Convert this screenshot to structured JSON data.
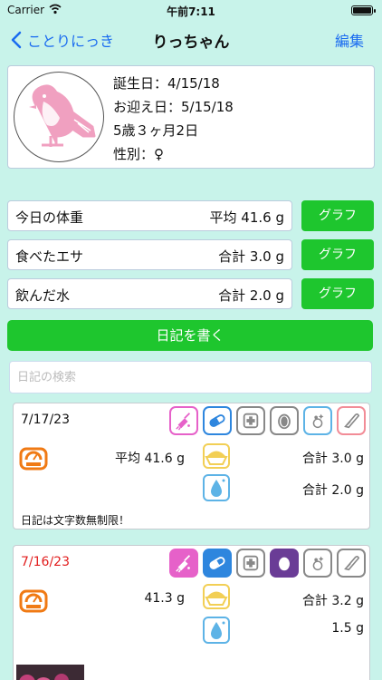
{
  "status_bar": {
    "carrier": "Carrier",
    "time": "午前7:11"
  },
  "nav": {
    "back_label": "ことりにっき",
    "title": "りっちゃん",
    "edit_label": "編集"
  },
  "profile": {
    "birthday": "誕生日：4/15/18",
    "welcome_day": "お迎え日：5/15/18",
    "age": "5歳３ヶ月2日",
    "sex": "性別：♀"
  },
  "stats": [
    {
      "label": "今日の体重",
      "value": "平均 41.6 g",
      "button": "グラフ"
    },
    {
      "label": "食べたエサ",
      "value": "合計 3.0 g",
      "button": "グラフ"
    },
    {
      "label": "飲んだ水",
      "value": "合計 2.0 g",
      "button": "グラフ"
    }
  ],
  "write_button": "日記を書く",
  "search": {
    "placeholder": "日記の検索"
  },
  "entries": [
    {
      "date": "7/17/23",
      "date_color": "#111111",
      "weight": "平均 41.6 g",
      "food": "合計 3.0 g",
      "water": "合計 2.0 g",
      "note": "日記は文字数無制限！",
      "icons": [
        "cleaning-icon",
        "medicine-icon",
        "hospital-icon",
        "egg-icon",
        "bath-icon",
        "nail-clipping-icon"
      ],
      "egg_filled": false
    },
    {
      "date": "7/16/23",
      "date_color": "#e21e1e",
      "weight": "41.3 g",
      "food": "合計 3.2 g",
      "water": "1.5 g",
      "icons": [
        "cleaning-icon",
        "medicine-icon",
        "hospital-icon",
        "egg-icon",
        "bath-icon",
        "nail-clipping-icon"
      ],
      "egg_filled": true
    }
  ],
  "colors": {
    "background": "#c8f3ea",
    "accent_blue": "#1a6bf0",
    "green_button": "#1ec62e",
    "scale_orange": "#f07a14",
    "food_yellow": "#f2cf55",
    "water_blue": "#5db3e6",
    "cleaning_pink": "#e661c9",
    "medicine_blue": "#2e86de",
    "gray_icon": "#888888",
    "egg_purple": "#6a3c96",
    "nail_pink": "#f28c97",
    "bird_pink": "#f0a0c0"
  }
}
